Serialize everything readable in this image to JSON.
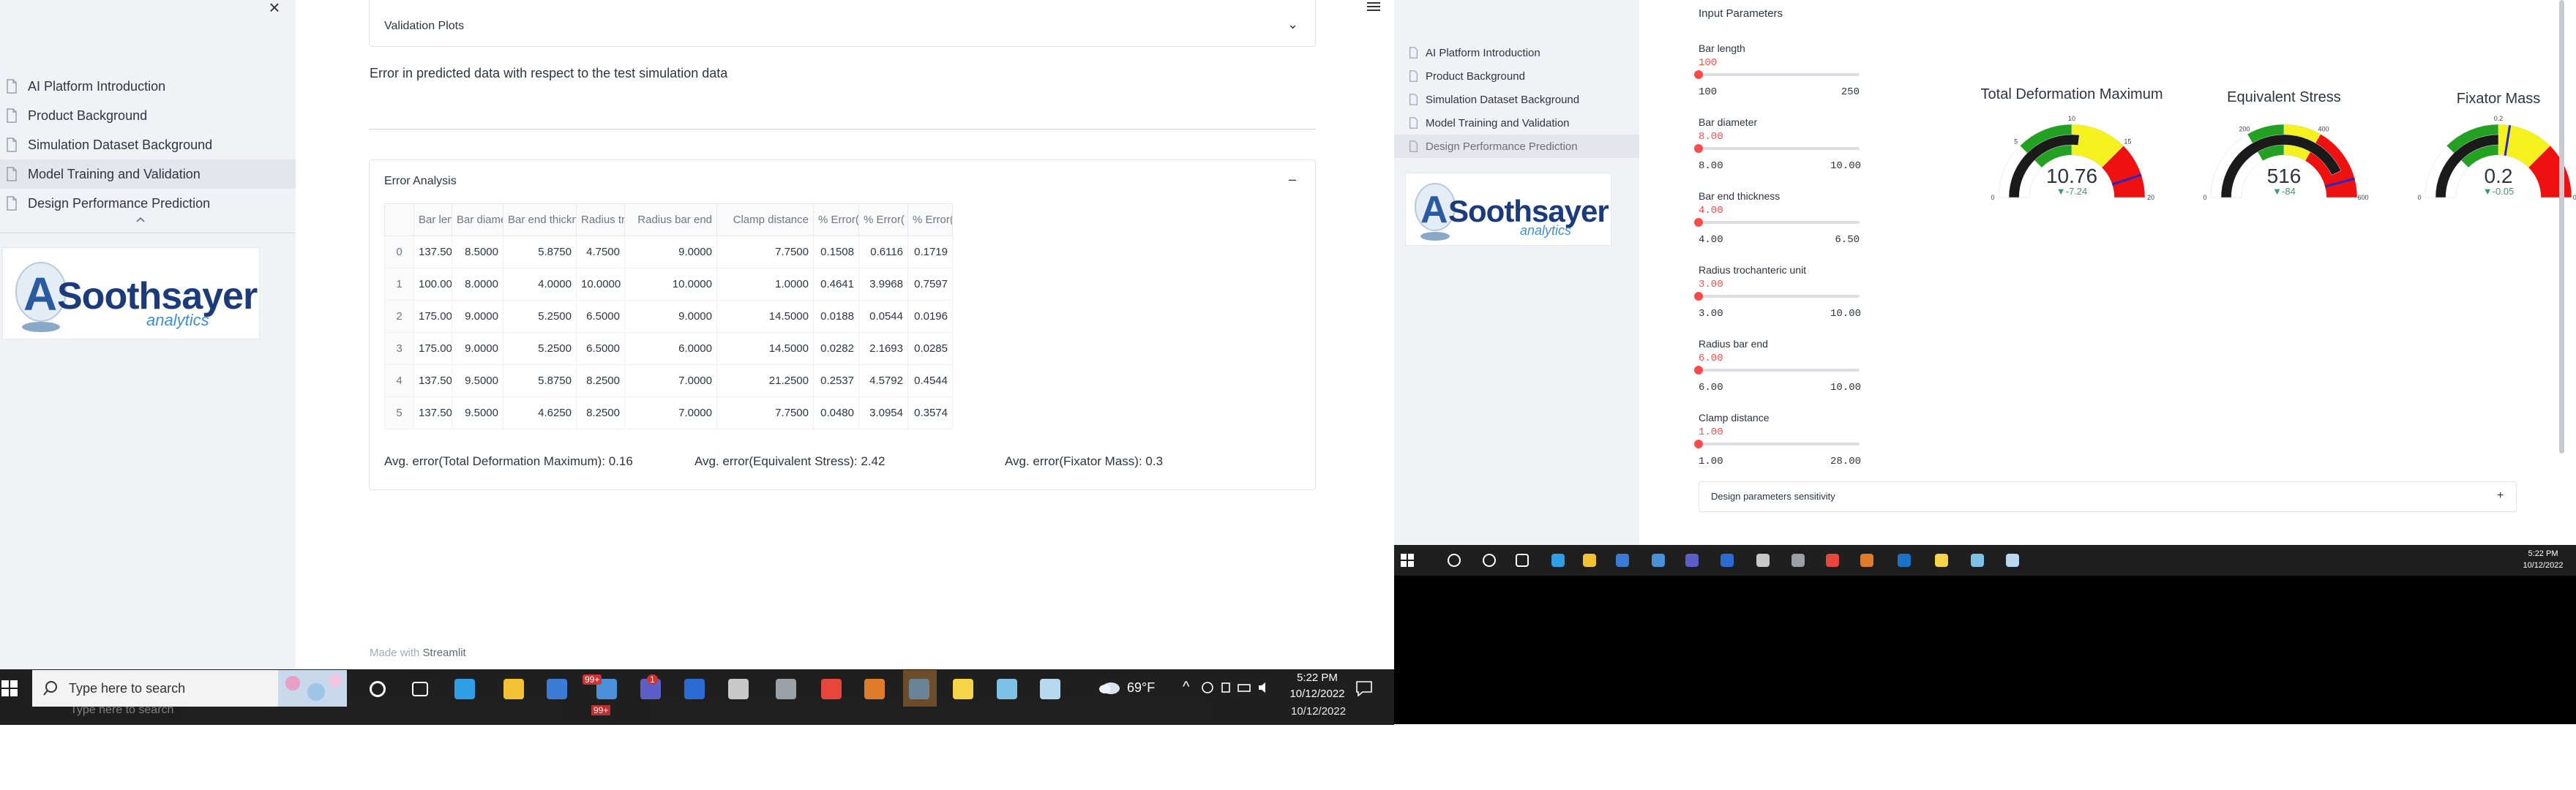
{
  "left_app": {
    "sidebar": {
      "close": "×",
      "items": [
        {
          "label": "AI Platform Introduction",
          "active": false
        },
        {
          "label": "Product Background",
          "active": false
        },
        {
          "label": "Simulation Dataset Background",
          "active": false
        },
        {
          "label": "Model Training and Validation",
          "active": true
        },
        {
          "label": "Design Performance Prediction",
          "active": false
        }
      ],
      "logo": {
        "word": "Soothsayer",
        "sub": "analytics",
        "mark": "A"
      }
    },
    "main": {
      "validation_plots_title": "Validation Plots",
      "error_text": "Error in predicted data with respect to the test simulation data",
      "error_analysis_title": "Error Analysis",
      "error_analysis_toggle": "–",
      "validation_toggle": "⌄",
      "table": {
        "columns": [
          "",
          "Bar length",
          "Bar diameter",
          "Bar end thickness",
          "Radius tr",
          "Radius bar end",
          "Clamp distance",
          "% Error(",
          "% Error(",
          "% Error("
        ],
        "rows": [
          [
            "0",
            "137.5000",
            "8.5000",
            "5.8750",
            "4.7500",
            "9.0000",
            "7.7500",
            "0.1508",
            "0.6116",
            "0.1719"
          ],
          [
            "1",
            "100.0000",
            "8.0000",
            "4.0000",
            "10.0000",
            "10.0000",
            "1.0000",
            "0.4641",
            "3.9968",
            "0.7597"
          ],
          [
            "2",
            "175.0000",
            "9.0000",
            "5.2500",
            "6.5000",
            "9.0000",
            "14.5000",
            "0.0188",
            "0.0544",
            "0.0196"
          ],
          [
            "3",
            "175.0000",
            "9.0000",
            "5.2500",
            "6.5000",
            "6.0000",
            "14.5000",
            "0.0282",
            "2.1693",
            "0.0285"
          ],
          [
            "4",
            "137.5000",
            "9.5000",
            "5.8750",
            "8.2500",
            "7.0000",
            "21.2500",
            "0.2537",
            "4.5792",
            "0.4544"
          ],
          [
            "5",
            "137.5000",
            "9.5000",
            "4.6250",
            "8.2500",
            "7.0000",
            "7.7500",
            "0.0480",
            "3.0954",
            "0.3574"
          ]
        ]
      },
      "avg_errors": [
        "Avg. error(Total Deformation Maximum): 0.16",
        "Avg. error(Equivalent Stress): 2.42",
        "Avg. error(Fixator Mass): 0.3"
      ],
      "made_with": "Made with",
      "made_with_brand": "Streamlit"
    },
    "taskbar": {
      "search_placeholder": "Type here to search",
      "ghost_search": "Type here to search",
      "weather": "69°F",
      "time": "5:22 PM",
      "date": "10/12/2022",
      "date2": "10/12/2022",
      "badge_mail": "99+",
      "badge_mail2": "99+",
      "badge_teams": "1"
    }
  },
  "right_app": {
    "sidebar": {
      "items": [
        {
          "label": "AI Platform Introduction",
          "active": false
        },
        {
          "label": "Product Background",
          "active": false
        },
        {
          "label": "Simulation Dataset Background",
          "active": false
        },
        {
          "label": "Model Training and Validation",
          "active": false
        },
        {
          "label": "Design Performance Prediction",
          "active": true
        }
      ],
      "logo": {
        "word": "Soothsayer",
        "sub": "analytics",
        "mark": "A"
      }
    },
    "input_title": "Input Parameters",
    "sliders": [
      {
        "label": "Bar length",
        "value": "100",
        "min": "100",
        "max": "250",
        "fraction": 0
      },
      {
        "label": "Bar diameter",
        "value": "8.00",
        "min": "8.00",
        "max": "10.00",
        "fraction": 0
      },
      {
        "label": "Bar end thickness",
        "value": "4.00",
        "min": "4.00",
        "max": "6.50",
        "fraction": 0
      },
      {
        "label": "Radius trochanteric unit",
        "value": "3.00",
        "min": "3.00",
        "max": "10.00",
        "fraction": 0
      },
      {
        "label": "Radius bar end",
        "value": "6.00",
        "min": "6.00",
        "max": "10.00",
        "fraction": 0
      },
      {
        "label": "Clamp distance",
        "value": "1.00",
        "min": "1.00",
        "max": "28.00",
        "fraction": 0
      }
    ],
    "gauges": [
      {
        "title": "Total Deformation Maximum",
        "value": "10.76",
        "delta": "▼-7.24",
        "min": 0,
        "max": 20,
        "val": 10.76,
        "threshold": 18,
        "ticks": [
          "0",
          "5",
          "10",
          "15",
          "20"
        ],
        "steps": [
          [
            0,
            5,
            "#ffffff"
          ],
          [
            5,
            10,
            "#22a122"
          ],
          [
            10,
            15,
            "#f4f11e"
          ],
          [
            15,
            20,
            "#ef1010"
          ]
        ]
      },
      {
        "title": "Equivalent Stress",
        "value": "516",
        "delta": "▼-84",
        "min": 0,
        "max": 600,
        "val": 516,
        "threshold": 550,
        "ticks": [
          "0",
          "200",
          "400",
          "600"
        ],
        "steps": [
          [
            0,
            200,
            "#ffffff"
          ],
          [
            200,
            300,
            "#22a122"
          ],
          [
            300,
            400,
            "#f4f11e"
          ],
          [
            400,
            600,
            "#ef1010"
          ]
        ]
      },
      {
        "title": "Fixator Mass",
        "value": "0.2",
        "delta": "▼-0.05",
        "min": 0,
        "max": 0.4,
        "val": 0.2,
        "threshold": 0.22,
        "ticks": [
          "0",
          "0.2",
          "0.4"
        ],
        "steps": [
          [
            0,
            0.1,
            "#ffffff"
          ],
          [
            0.1,
            0.2,
            "#22a122"
          ],
          [
            0.2,
            0.3,
            "#f4f11e"
          ],
          [
            0.3,
            0.4,
            "#ef1010"
          ]
        ]
      }
    ],
    "sensitivity_title": "Design parameters sensitivity",
    "sensitivity_toggle": "+",
    "taskbar": {
      "time": "5:22 PM",
      "date": "10/12/2022"
    }
  },
  "colors": {
    "accent": "#ff4b4b",
    "sidebar_bg": "#f0f2f6",
    "taskbar": "#1f1f1f",
    "gauge_bar": "#1a1a1a",
    "delta_down": "#3d9970",
    "threshold": "#2727c9"
  }
}
